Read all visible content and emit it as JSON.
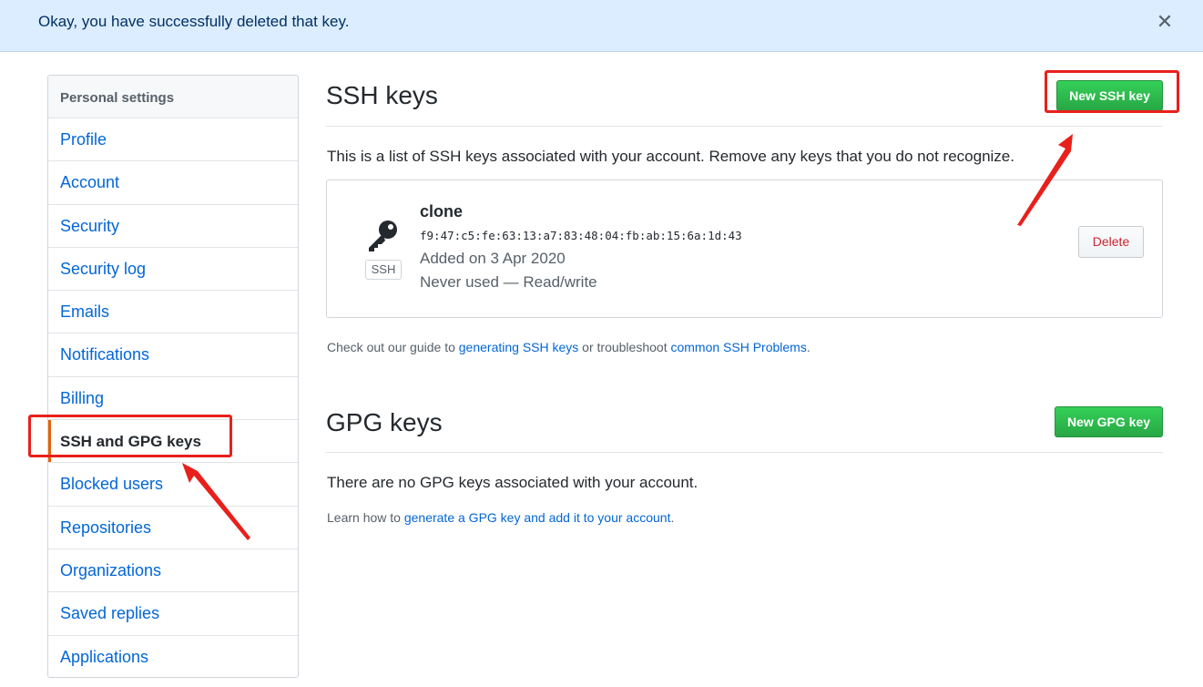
{
  "flash": {
    "message": "Okay, you have successfully deleted that key.",
    "close_glyph": "✕"
  },
  "sidebar": {
    "heading": "Personal settings",
    "items": [
      {
        "label": "Profile"
      },
      {
        "label": "Account"
      },
      {
        "label": "Security"
      },
      {
        "label": "Security log"
      },
      {
        "label": "Emails"
      },
      {
        "label": "Notifications"
      },
      {
        "label": "Billing"
      },
      {
        "label": "SSH and GPG keys",
        "selected": true
      },
      {
        "label": "Blocked users"
      },
      {
        "label": "Repositories"
      },
      {
        "label": "Organizations"
      },
      {
        "label": "Saved replies"
      },
      {
        "label": "Applications"
      }
    ]
  },
  "ssh": {
    "title": "SSH keys",
    "new_button": "New SSH key",
    "description": "This is a list of SSH keys associated with your account. Remove any keys that you do not recognize.",
    "key": {
      "icon": "key-icon",
      "type_label": "SSH",
      "title": "clone",
      "fingerprint": "f9:47:c5:fe:63:13:a7:83:48:04:fb:ab:15:6a:1d:43",
      "added": "Added on 3 Apr 2020",
      "usage": "Never used — Read/write",
      "delete_button": "Delete"
    },
    "help": {
      "prefix": "Check out our guide to ",
      "link1": "generating SSH keys",
      "middle": " or troubleshoot ",
      "link2": "common SSH Problems",
      "suffix": "."
    }
  },
  "gpg": {
    "title": "GPG keys",
    "new_button": "New GPG key",
    "empty_message": "There are no GPG keys associated with your account.",
    "help": {
      "prefix": "Learn how to ",
      "link": "generate a GPG key and add it to your account",
      "suffix": "."
    }
  },
  "colors": {
    "link": "#0366d6",
    "primary_button": "#28a745",
    "flash_bg": "#dbedff",
    "annotation": "#e8201c",
    "selected_marker": "#e36209"
  }
}
